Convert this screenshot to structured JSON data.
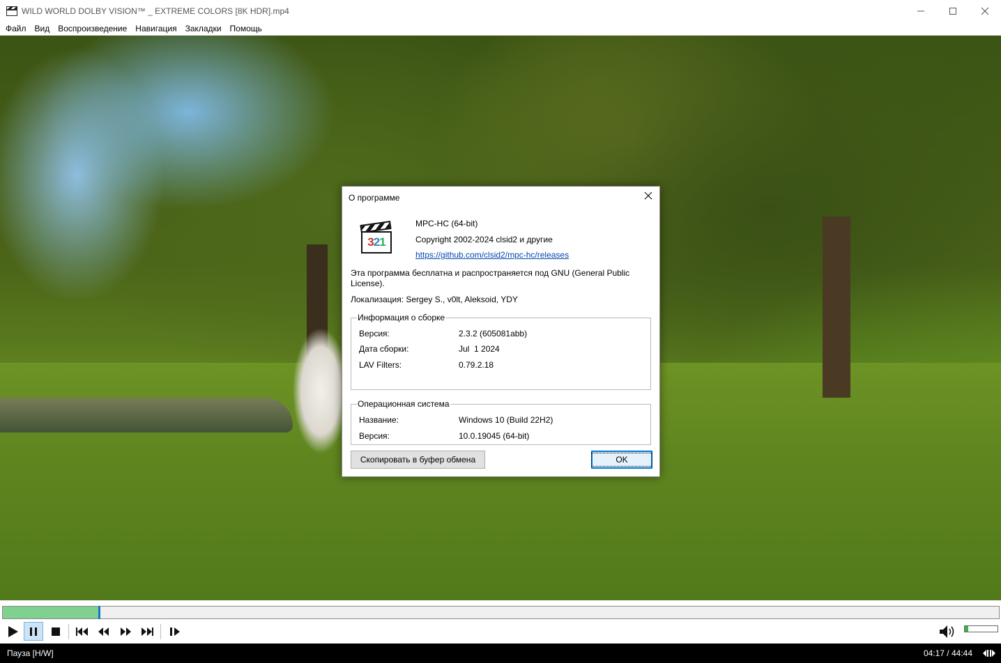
{
  "window": {
    "title": "WILD WORLD DOLBY VISION™ _ EXTREME COLORS [8K HDR].mp4",
    "minimize": "—",
    "maximize": "☐",
    "close": "✕"
  },
  "menu": [
    "Файл",
    "Вид",
    "Воспроизведение",
    "Навигация",
    "Закладки",
    "Помощь"
  ],
  "about_dialog": {
    "title": "О программе",
    "close": "✕",
    "product": "MPC-HC (64-bit)",
    "copyright": "Copyright 2002-2024 clsid2 и другие",
    "link": "https://github.com/clsid2/mpc-hc/releases",
    "license": "Эта программа бесплатна и распространяется под GNU (General Public License).",
    "localization": "Локализация: Sergey S., v0lt, Aleksoid, YDY",
    "build_group": {
      "legend": "Информация о сборке",
      "rows": [
        {
          "label": "Версия:",
          "value": "2.3.2 (605081abb)"
        },
        {
          "label": "Дата сборки:",
          "value": "Jul  1 2024"
        },
        {
          "label": "LAV Filters:",
          "value": "0.79.2.18"
        }
      ]
    },
    "os_group": {
      "legend": "Операционная система",
      "rows": [
        {
          "label": "Название:",
          "value": "Windows 10 (Build 22H2)"
        },
        {
          "label": "Версия:",
          "value": "10.0.19045 (64-bit)"
        }
      ]
    },
    "copy_button": "Скопировать в буфер обмена",
    "ok_button": "OK"
  },
  "player": {
    "position": "04:17",
    "duration": "44:44",
    "progress": 0.0957,
    "volume": 0.1,
    "status": "Пауза [H/W]",
    "time_display": "04:17 / 44:44",
    "colors": {
      "seek_fill": "#80d090",
      "seek_thumb": "#1a73c8",
      "volume_fill": "#3cb04a"
    }
  }
}
